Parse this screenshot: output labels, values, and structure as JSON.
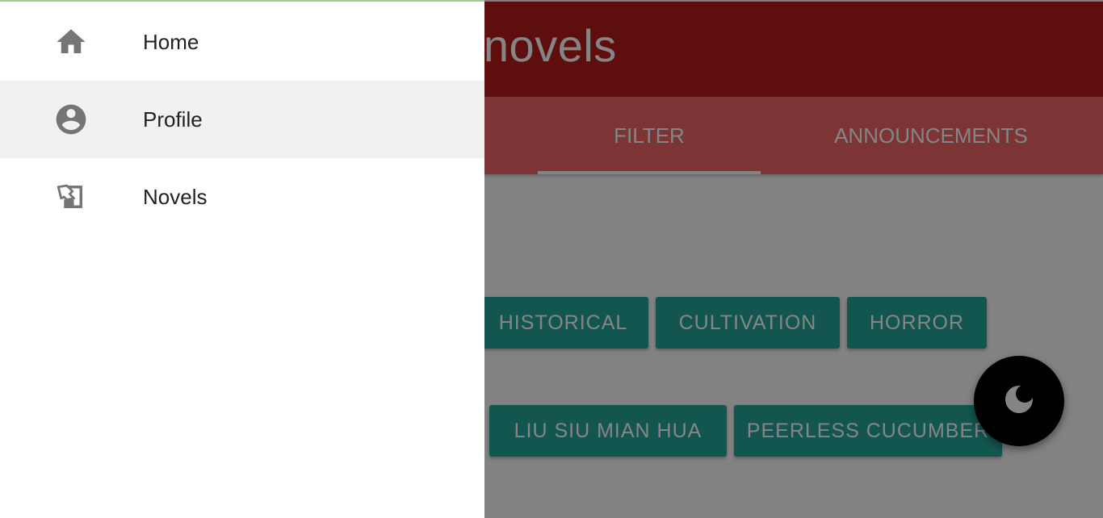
{
  "app": {
    "title": "Y/novels"
  },
  "tabs": [
    {
      "label": "FILTER",
      "active": true
    },
    {
      "label": "ANNOUNCEMENTS",
      "active": false
    }
  ],
  "chips": [
    {
      "label": "HISTORICAL"
    },
    {
      "label": "CULTIVATION"
    },
    {
      "label": "HORROR"
    },
    {
      "label": "LIU SIU MIAN HUA"
    },
    {
      "label": "PEERLESS CUCUMBER"
    }
  ],
  "fab": {
    "icon": "moon-icon"
  },
  "drawer": {
    "items": [
      {
        "label": "Home",
        "icon": "home-icon",
        "active": false
      },
      {
        "label": "Profile",
        "icon": "account-circle-icon",
        "active": true
      },
      {
        "label": "Novels",
        "icon": "novels-icon",
        "active": false
      }
    ]
  },
  "colors": {
    "header": "#b71c1c",
    "tab_bar": "#ee6565",
    "chip": "#26a69a",
    "drawer_active": "#f1f1f1",
    "fab": "#000000",
    "icon": "#757575"
  }
}
